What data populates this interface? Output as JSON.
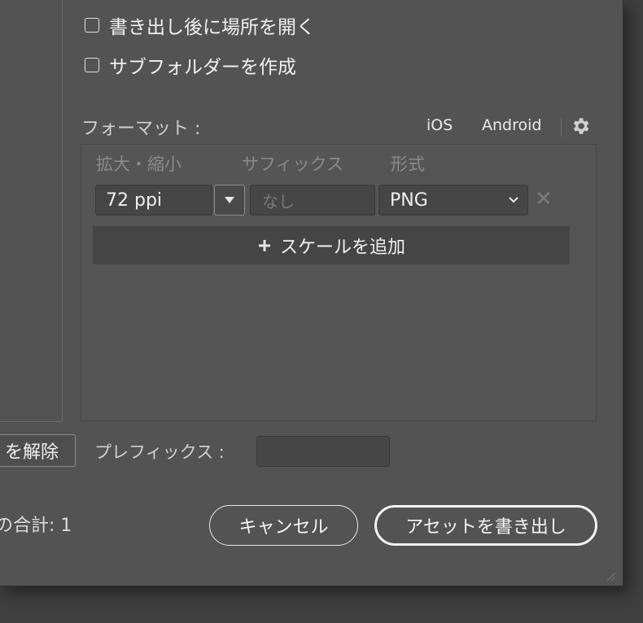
{
  "options": {
    "open_location_label": "書き出し後に場所を開く",
    "create_subfolders_label": "サブフォルダーを作成"
  },
  "format": {
    "label": "フォーマット :",
    "tabs": [
      "iOS",
      "Android"
    ],
    "columns": {
      "scale": "拡大・縮小",
      "suffix": "サフィックス",
      "type": "形式"
    },
    "row": {
      "scale_value": "72 ppi",
      "suffix_placeholder": "なし",
      "format_value": "PNG"
    },
    "add_scale_label": "スケールを追加"
  },
  "selection": {
    "unselect_label": "を解除"
  },
  "prefix": {
    "label": "プレフィックス :",
    "value": ""
  },
  "summary": {
    "total_text": "の合計: 1"
  },
  "actions": {
    "cancel_label": "キャンセル",
    "export_label": "アセットを書き出し"
  },
  "icons": {
    "gear": "gear-icon",
    "dropdown": "triangle-down-icon",
    "chevron": "chevron-down-icon",
    "remove": "close-icon",
    "add": "plus-icon"
  }
}
